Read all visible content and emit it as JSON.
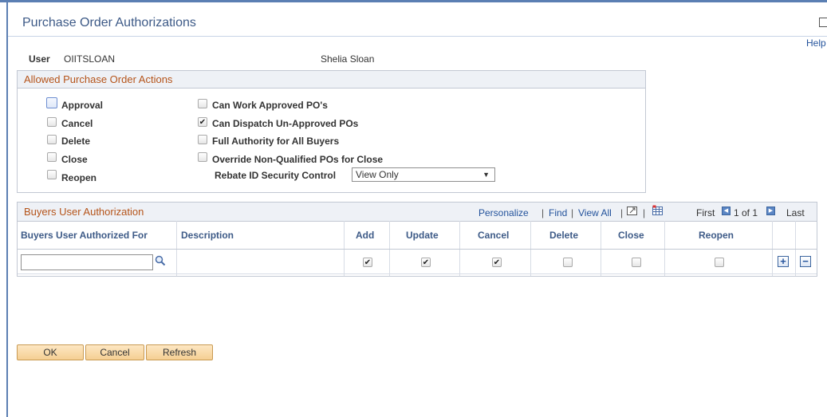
{
  "page": {
    "title": "Purchase Order Authorizations",
    "help_label": "Help"
  },
  "user": {
    "label": "User",
    "id": "OIITSLOAN",
    "name": "Shelia Sloan"
  },
  "allowed_actions": {
    "header": "Allowed Purchase Order Actions",
    "left_options": [
      {
        "label": "Approval",
        "checked": false
      },
      {
        "label": "Cancel",
        "checked": false
      },
      {
        "label": "Delete",
        "checked": false
      },
      {
        "label": "Close",
        "checked": false
      },
      {
        "label": "Reopen",
        "checked": false
      }
    ],
    "right_options": [
      {
        "label": "Can Work Approved PO's",
        "checked": false
      },
      {
        "label": "Can Dispatch Un-Approved POs",
        "checked": true
      },
      {
        "label": "Full Authority for All Buyers",
        "checked": false
      },
      {
        "label": "Override Non-Qualified POs for Close",
        "checked": false
      }
    ],
    "rebate": {
      "label": "Rebate ID Security Control",
      "value": "View Only"
    }
  },
  "buyers_grid": {
    "title": "Buyers User Authorization",
    "nav": {
      "personalize": "Personalize",
      "find": "Find",
      "view_all": "View All",
      "first": "First",
      "range": "1 of 1",
      "last": "Last",
      "sep": "|"
    },
    "columns": [
      "Buyers User Authorized For",
      "Description",
      "Add",
      "Update",
      "Cancel",
      "Delete",
      "Close",
      "Reopen"
    ],
    "rows": [
      {
        "buyer": "",
        "description": "",
        "add": true,
        "update": true,
        "cancel": true,
        "delete": false,
        "close": false,
        "reopen": false
      }
    ]
  },
  "buttons": {
    "ok": "OK",
    "cancel": "Cancel",
    "refresh": "Refresh"
  }
}
